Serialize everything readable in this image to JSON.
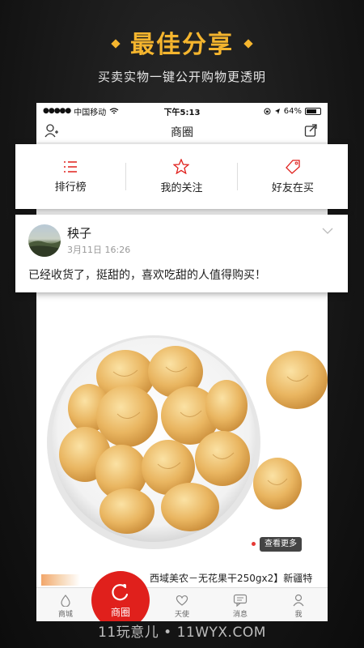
{
  "promo": {
    "headline": "最佳分享",
    "subheadline": "买卖实物一键公开购物更透明"
  },
  "statusbar": {
    "carrier": "中国移动",
    "time": "下午5:13",
    "battery": "64%"
  },
  "navbar": {
    "title": "商圈"
  },
  "tabs": [
    {
      "label": "排行榜",
      "icon": "list-icon"
    },
    {
      "label": "我的关注",
      "icon": "star-icon"
    },
    {
      "label": "好友在买",
      "icon": "tag-icon"
    }
  ],
  "post": {
    "username": "秧子",
    "date": "3月11日 16:26",
    "text": "已经收货了，挺甜的，喜欢吃甜的人值得购买！"
  },
  "product": {
    "more_label": "查看更多",
    "title": "西域美农－无花果干250gx2】新疆特"
  },
  "tabbar": [
    {
      "label": "商城",
      "icon": "drop-icon"
    },
    {
      "label": "商圈",
      "icon": "circle-icon"
    },
    {
      "label": "天使",
      "icon": "heart-icon"
    },
    {
      "label": "消息",
      "icon": "chat-icon"
    },
    {
      "label": "我",
      "icon": "person-icon"
    }
  ],
  "watermark": "11玩意儿 • 11WYX.COM",
  "colors": {
    "accent": "#e0201c",
    "headline": "#f5b52e"
  }
}
